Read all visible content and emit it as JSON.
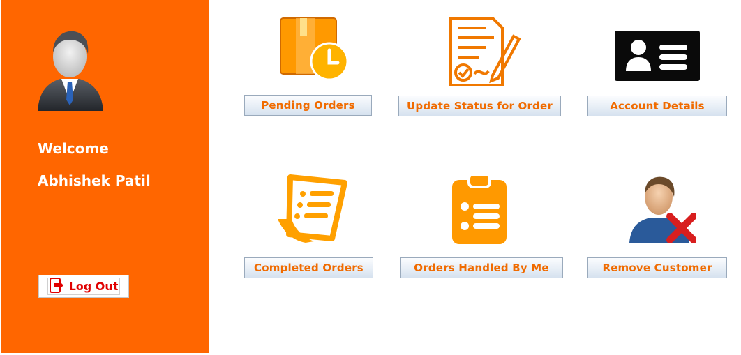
{
  "sidebar": {
    "welcome": "Welcome",
    "user_name": "Abhishek Patil",
    "logout_label": "Log Out",
    "background": "#ff6600"
  },
  "tiles": [
    {
      "label": "Pending Orders",
      "icon": "package-clock-icon"
    },
    {
      "label": "Update Status for Order",
      "icon": "document-signature-icon"
    },
    {
      "label": "Account Details",
      "icon": "id-card-icon"
    },
    {
      "label": "Completed Orders",
      "icon": "receipt-scroll-icon"
    },
    {
      "label": "Orders Handled By Me",
      "icon": "clipboard-list-icon"
    },
    {
      "label": "Remove Customer",
      "icon": "user-remove-icon"
    }
  ],
  "colors": {
    "accent": "#ff6600",
    "button_text": "#f06b00",
    "logout_text": "#e00000",
    "icon_orange": "#ff9900"
  }
}
